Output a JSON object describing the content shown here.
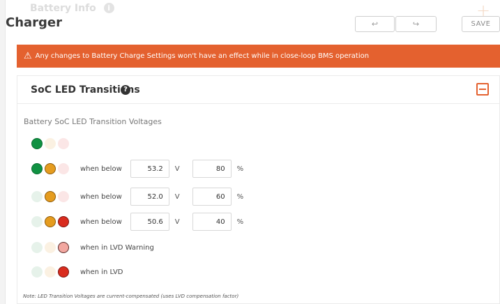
{
  "top_ghost": {
    "title": "Battery Info",
    "info": "i",
    "plus": "+"
  },
  "header": {
    "title": "Charger",
    "undo": "↩",
    "redo": "↪",
    "save": "SAVE"
  },
  "banner": {
    "icon": "⚠",
    "text": "Any changes to Battery Charge Settings won't have an effect while in close-loop BMS operation"
  },
  "card": {
    "title": "SoC LED Transitions",
    "help": "?",
    "section_label": "Battery SoC LED Transition Voltages",
    "rows": [
      {
        "leds": [
          "green-on",
          "amber-off",
          "red-off"
        ]
      },
      {
        "leds": [
          "green-on",
          "amber-on",
          "red-off"
        ],
        "text": "when below",
        "voltage": "53.2",
        "volt_unit": "V",
        "percent": "80",
        "pct_unit": "%"
      },
      {
        "leds": [
          "green-off",
          "amber-on",
          "red-off"
        ],
        "text": "when below",
        "voltage": "52.0",
        "volt_unit": "V",
        "percent": "60",
        "pct_unit": "%"
      },
      {
        "leds": [
          "green-off",
          "amber-on",
          "red-on"
        ],
        "text": "when below",
        "voltage": "50.6",
        "volt_unit": "V",
        "percent": "40",
        "pct_unit": "%"
      },
      {
        "leds": [
          "green-off",
          "amber-off",
          "red-warn"
        ],
        "text": "when in LVD Warning"
      },
      {
        "leds": [
          "green-off",
          "amber-off",
          "red-on"
        ],
        "text": "when in LVD"
      }
    ],
    "note": "Note: LED Transition Voltages are current-compensated (uses LVD compensation factor)"
  },
  "colors": {
    "accent": "#e4612f",
    "green": "#109142",
    "amber": "#e59c1f",
    "red": "#d92c1e"
  }
}
